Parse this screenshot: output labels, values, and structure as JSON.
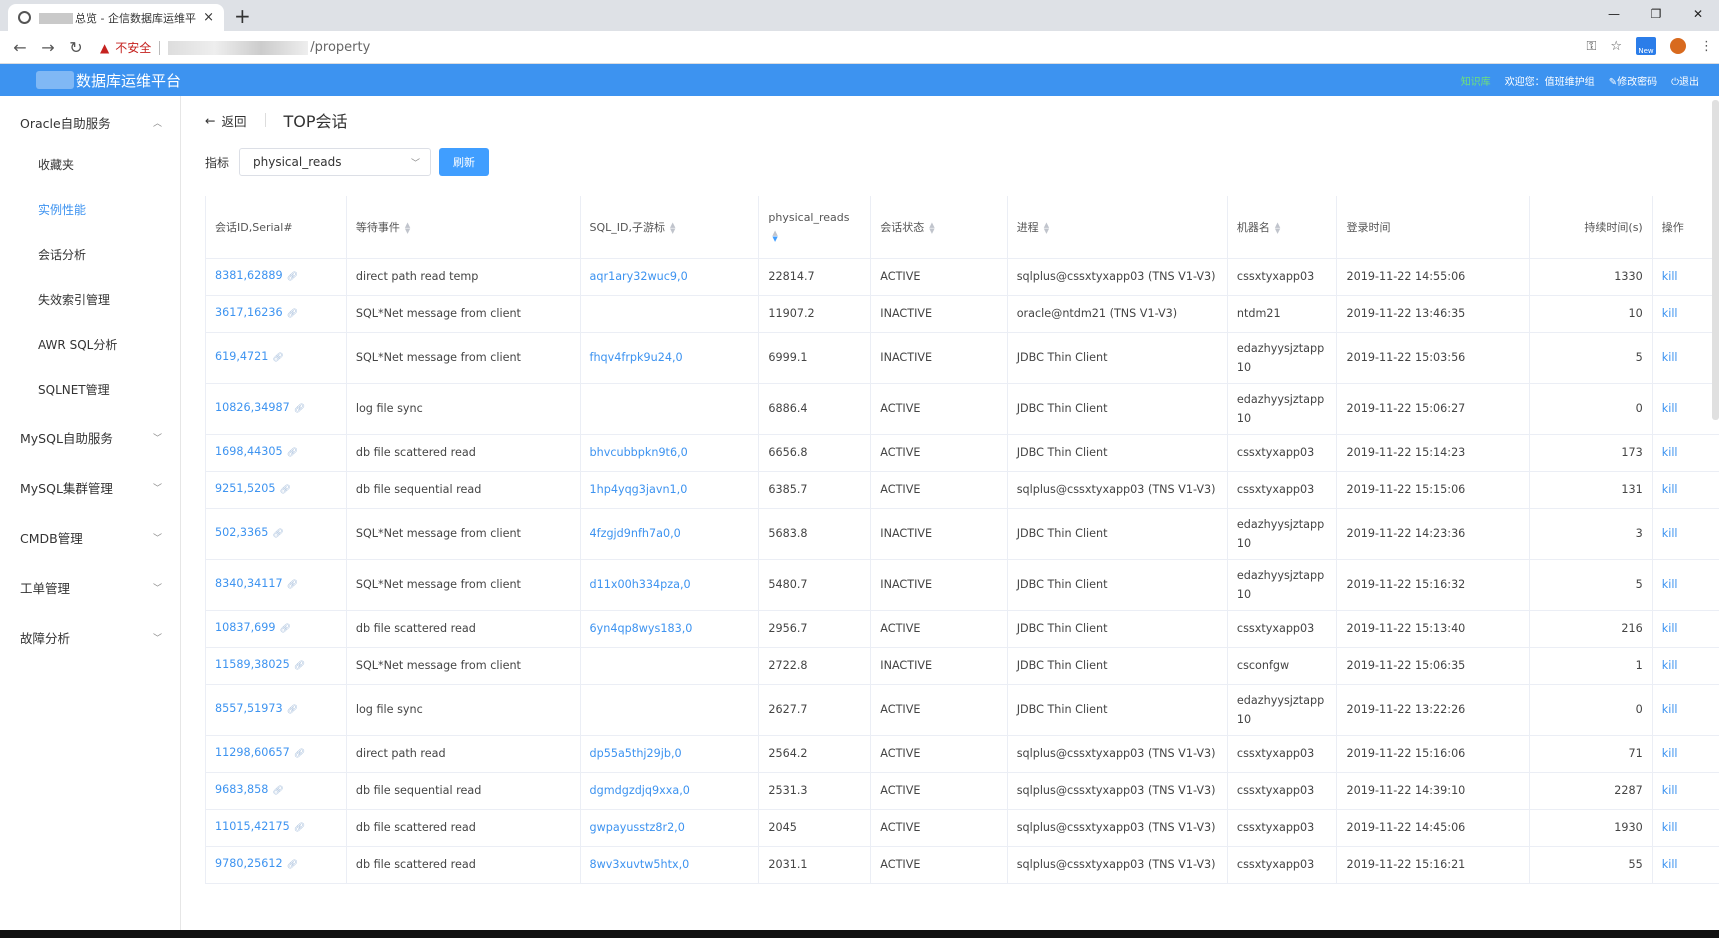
{
  "browser": {
    "tab_title": "总览 - 企信数据库运维平台",
    "tab_close": "×",
    "new_tab": "+",
    "insecure_label": "不安全",
    "url_path": "/property",
    "ext_new_label": "New"
  },
  "header": {
    "title": "数据库运维平台",
    "knowledge": "知识库",
    "welcome": "欢迎您：值班维护组",
    "change_password": "修改密码",
    "logout": "退出"
  },
  "sidebar": {
    "groups": [
      {
        "label": "Oracle自助服务"
      },
      {
        "label": "MySQL自助服务"
      },
      {
        "label": "MySQL集群管理"
      },
      {
        "label": "CMDB管理"
      },
      {
        "label": "工单管理"
      },
      {
        "label": "故障分析"
      }
    ],
    "oracle_items": [
      {
        "label": "收藏夹"
      },
      {
        "label": "实例性能"
      },
      {
        "label": "会话分析"
      },
      {
        "label": "失效索引管理"
      },
      {
        "label": "AWR SQL分析"
      },
      {
        "label": "SQLNET管理"
      }
    ]
  },
  "page": {
    "back_label": "返回",
    "title": "TOP会话",
    "filter_label": "指标",
    "metric_selected": "physical_reads",
    "refresh_label": "刷新"
  },
  "table": {
    "headers": [
      "会话ID,Serial#",
      "等待事件",
      "SQL_ID,子游标",
      "physical_reads",
      "会话状态",
      "进程",
      "机器名",
      "登录时间",
      "持续时间(s)",
      "操作"
    ],
    "action_label": "kill",
    "rows": [
      {
        "sid": "8381,62889",
        "event": "direct path read temp",
        "sql": "aqr1ary32wuc9,0",
        "reads": "22814.7",
        "status": "ACTIVE",
        "proc": "sqlplus@cssxtyxapp03 (TNS V1-V3)",
        "machine": "cssxtyxapp03",
        "login": "2019-11-22 14:55:06",
        "dur": "1330"
      },
      {
        "sid": "3617,16236",
        "event": "SQL*Net message from client",
        "sql": "",
        "reads": "11907.2",
        "status": "INACTIVE",
        "proc": "oracle@ntdm21 (TNS V1-V3)",
        "machine": "ntdm21",
        "login": "2019-11-22 13:46:35",
        "dur": "10"
      },
      {
        "sid": "619,4721",
        "event": "SQL*Net message from client",
        "sql": "fhqv4frpk9u24,0",
        "reads": "6999.1",
        "status": "INACTIVE",
        "proc": "JDBC Thin Client",
        "machine": "edazhyysjztapp10",
        "login": "2019-11-22 15:03:56",
        "dur": "5"
      },
      {
        "sid": "10826,34987",
        "event": "log file sync",
        "sql": "",
        "reads": "6886.4",
        "status": "ACTIVE",
        "proc": "JDBC Thin Client",
        "machine": "edazhyysjztapp10",
        "login": "2019-11-22 15:06:27",
        "dur": "0"
      },
      {
        "sid": "1698,44305",
        "event": "db file scattered read",
        "sql": "bhvcubbpkn9t6,0",
        "reads": "6656.8",
        "status": "ACTIVE",
        "proc": "JDBC Thin Client",
        "machine": "cssxtyxapp03",
        "login": "2019-11-22 15:14:23",
        "dur": "173"
      },
      {
        "sid": "9251,5205",
        "event": "db file sequential read",
        "sql": "1hp4yqg3javn1,0",
        "reads": "6385.7",
        "status": "ACTIVE",
        "proc": "sqlplus@cssxtyxapp03 (TNS V1-V3)",
        "machine": "cssxtyxapp03",
        "login": "2019-11-22 15:15:06",
        "dur": "131"
      },
      {
        "sid": "502,3365",
        "event": "SQL*Net message from client",
        "sql": "4fzgjd9nfh7a0,0",
        "reads": "5683.8",
        "status": "INACTIVE",
        "proc": "JDBC Thin Client",
        "machine": "edazhyysjztapp10",
        "login": "2019-11-22 14:23:36",
        "dur": "3"
      },
      {
        "sid": "8340,34117",
        "event": "SQL*Net message from client",
        "sql": "d11x00h334pza,0",
        "reads": "5480.7",
        "status": "INACTIVE",
        "proc": "JDBC Thin Client",
        "machine": "edazhyysjztapp10",
        "login": "2019-11-22 15:16:32",
        "dur": "5"
      },
      {
        "sid": "10837,699",
        "event": "db file scattered read",
        "sql": "6yn4qp8wys183,0",
        "reads": "2956.7",
        "status": "ACTIVE",
        "proc": "JDBC Thin Client",
        "machine": "cssxtyxapp03",
        "login": "2019-11-22 15:13:40",
        "dur": "216"
      },
      {
        "sid": "11589,38025",
        "event": "SQL*Net message from client",
        "sql": "",
        "reads": "2722.8",
        "status": "INACTIVE",
        "proc": "JDBC Thin Client",
        "machine": "csconfgw",
        "login": "2019-11-22 15:06:35",
        "dur": "1"
      },
      {
        "sid": "8557,51973",
        "event": "log file sync",
        "sql": "",
        "reads": "2627.7",
        "status": "ACTIVE",
        "proc": "JDBC Thin Client",
        "machine": "edazhyysjztapp10",
        "login": "2019-11-22 13:22:26",
        "dur": "0"
      },
      {
        "sid": "11298,60657",
        "event": "direct path read",
        "sql": "dp55a5thj29jb,0",
        "reads": "2564.2",
        "status": "ACTIVE",
        "proc": "sqlplus@cssxtyxapp03 (TNS V1-V3)",
        "machine": "cssxtyxapp03",
        "login": "2019-11-22 15:16:06",
        "dur": "71"
      },
      {
        "sid": "9683,858",
        "event": "db file sequential read",
        "sql": "dgmdgzdjq9xxa,0",
        "reads": "2531.3",
        "status": "ACTIVE",
        "proc": "sqlplus@cssxtyxapp03 (TNS V1-V3)",
        "machine": "cssxtyxapp03",
        "login": "2019-11-22 14:39:10",
        "dur": "2287"
      },
      {
        "sid": "11015,42175",
        "event": "db file scattered read",
        "sql": "gwpayusstz8r2,0",
        "reads": "2045",
        "status": "ACTIVE",
        "proc": "sqlplus@cssxtyxapp03 (TNS V1-V3)",
        "machine": "cssxtyxapp03",
        "login": "2019-11-22 14:45:06",
        "dur": "1930"
      },
      {
        "sid": "9780,25612",
        "event": "db file scattered read",
        "sql": "8wv3xuvtw5htx,0",
        "reads": "2031.1",
        "status": "ACTIVE",
        "proc": "sqlplus@cssxtyxapp03 (TNS V1-V3)",
        "machine": "cssxtyxapp03",
        "login": "2019-11-22 15:16:21",
        "dur": "55"
      }
    ]
  }
}
